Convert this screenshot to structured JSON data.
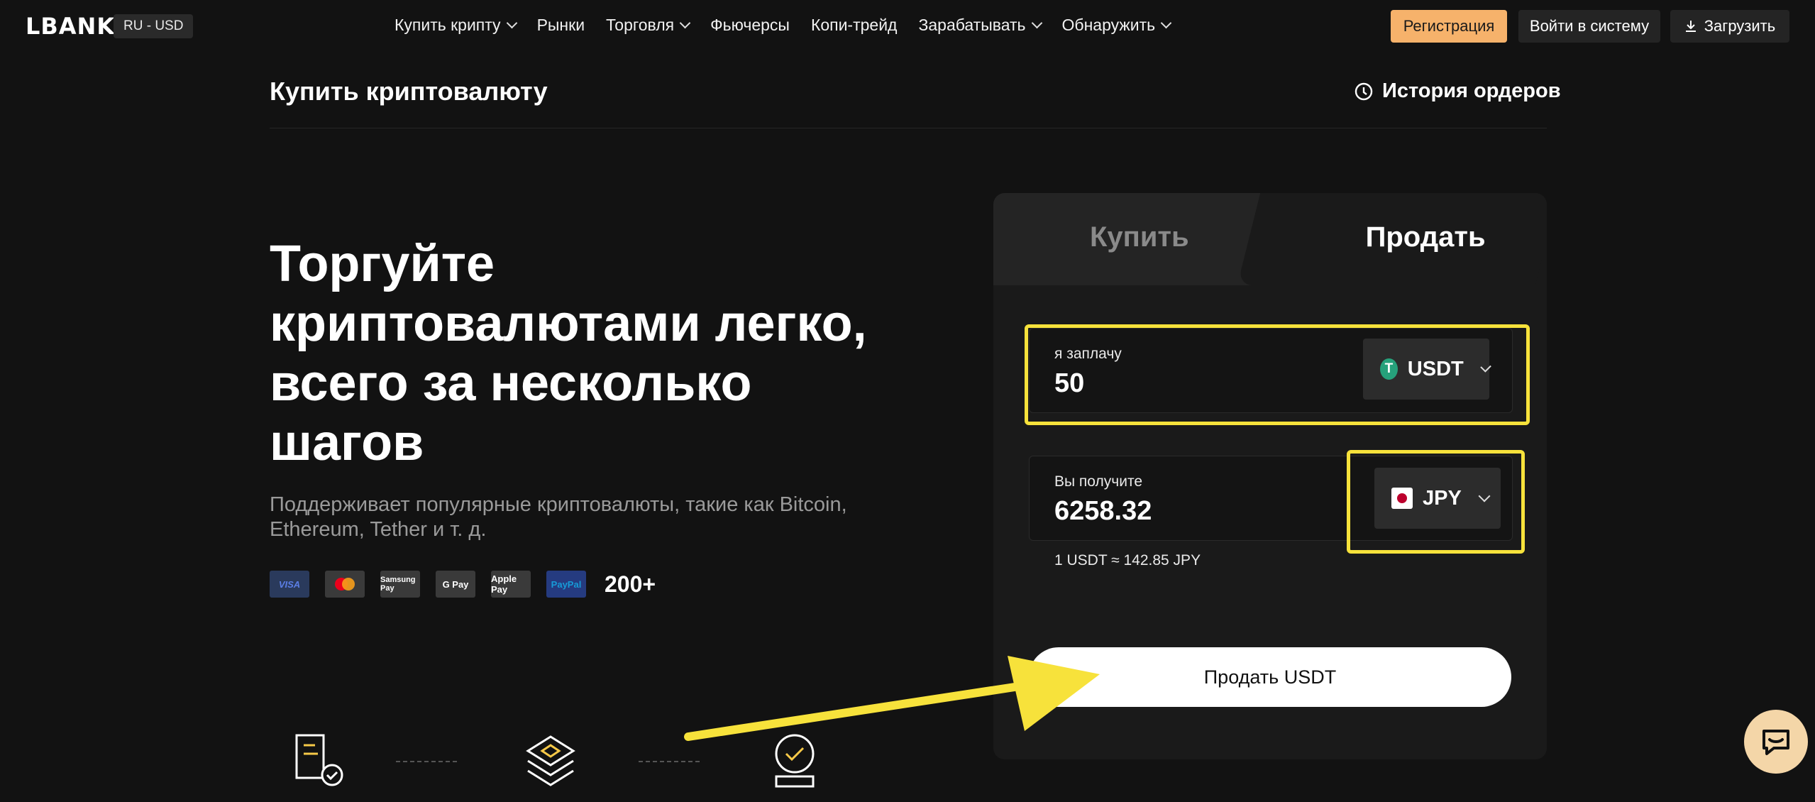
{
  "header": {
    "logo": "LBANK",
    "locale": "RU - USD",
    "nav": [
      {
        "label": "Купить крипту",
        "dropdown": true
      },
      {
        "label": "Рынки",
        "dropdown": false
      },
      {
        "label": "Торговля",
        "dropdown": true
      },
      {
        "label": "Фьючерсы",
        "dropdown": false
      },
      {
        "label": "Копи-трейд",
        "dropdown": false
      },
      {
        "label": "Зарабатывать",
        "dropdown": true
      },
      {
        "label": "Обнаружить",
        "dropdown": true
      }
    ],
    "register": "Регистрация",
    "login": "Войти в систему",
    "download": "Загрузить"
  },
  "page": {
    "title": "Купить криптовалюту",
    "order_history": "История ордеров"
  },
  "hero": {
    "title": "Торгуйте криптовалютами легко, всего за несколько шагов",
    "subtitle": "Поддерживает популярные криптовалюты, такие как Bitcoin, Ethereum, Tether и т. д.",
    "payment_methods": [
      "VISA",
      "Mastercard",
      "Samsung Pay",
      "G Pay",
      "Apple Pay",
      "PayPal"
    ],
    "more": "200+"
  },
  "trade": {
    "tabs": {
      "buy": "Купить",
      "sell": "Продать"
    },
    "active_tab": "sell",
    "pay": {
      "label": "я заплачу",
      "value": "50",
      "currency": "USDT"
    },
    "receive": {
      "label": "Вы получите",
      "value": "6258.32",
      "currency": "JPY"
    },
    "rate": "1 USDT ≈ 142.85 JPY",
    "submit": "Продать USDT"
  },
  "colors": {
    "background": "#121212",
    "accent": "#f6b26b",
    "highlight": "#f7e23b",
    "tether": "#26a17b"
  },
  "icons": {
    "order_history": "clock-history-icon",
    "download": "download-icon",
    "chat": "chat-icon",
    "steps": [
      "document-check-icon",
      "layers-icon",
      "verified-badge-icon"
    ]
  }
}
